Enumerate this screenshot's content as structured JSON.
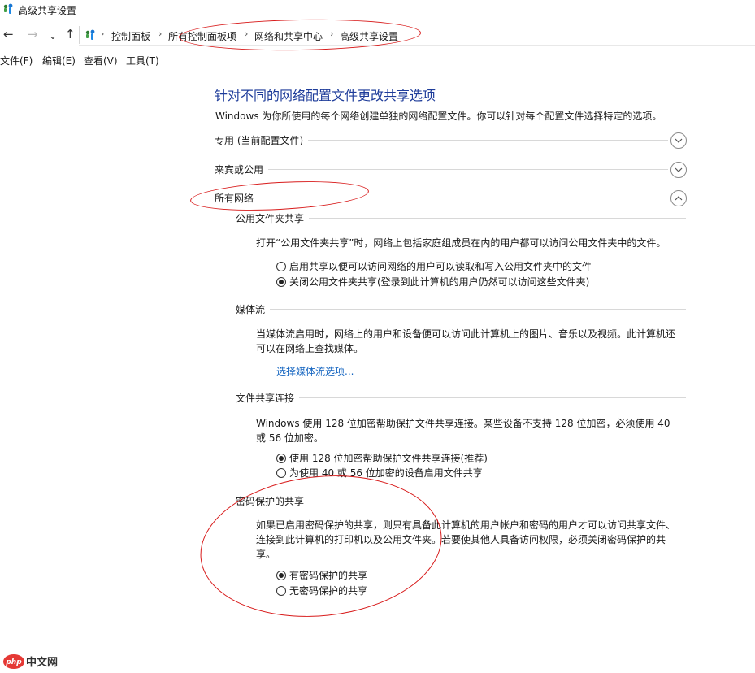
{
  "window": {
    "title": "高级共享设置"
  },
  "navigation": {
    "back": "←",
    "forward": "→",
    "recent": "⌄",
    "up": "↑"
  },
  "breadcrumb": [
    "控制面板",
    "所有控制面板项",
    "网络和共享中心",
    "高级共享设置"
  ],
  "menu": [
    "文件(F)",
    "编辑(E)",
    "查看(V)",
    "工具(T)"
  ],
  "content": {
    "heading": "针对不同的网络配置文件更改共享选项",
    "description": "Windows 为你所使用的每个网络创建单独的网络配置文件。你可以针对每个配置文件选择特定的选项。",
    "profiles": {
      "private": {
        "label": "专用 (当前配置文件)",
        "state": "collapsed",
        "icon": "chevron-down-icon"
      },
      "guest": {
        "label": "来宾或公用",
        "state": "collapsed",
        "icon": "chevron-down-icon"
      },
      "all": {
        "label": "所有网络",
        "state": "expanded",
        "icon": "chevron-up-icon"
      }
    },
    "public_folder": {
      "title": "公用文件夹共享",
      "text": "打开“公用文件夹共享”时，网络上包括家庭组成员在内的用户都可以访问公用文件夹中的文件。",
      "options": [
        {
          "label": "启用共享以便可以访问网络的用户可以读取和写入公用文件夹中的文件",
          "selected": false
        },
        {
          "label": "关闭公用文件夹共享(登录到此计算机的用户仍然可以访问这些文件夹)",
          "selected": true
        }
      ]
    },
    "media": {
      "title": "媒体流",
      "text": "当媒体流启用时，网络上的用户和设备便可以访问此计算机上的图片、音乐以及视频。此计算机还可以在网络上查找媒体。",
      "link": "选择媒体流选项..."
    },
    "file_sharing": {
      "title": "文件共享连接",
      "text": "Windows 使用 128 位加密帮助保护文件共享连接。某些设备不支持 128 位加密，必须使用 40 或 56 位加密。",
      "options": [
        {
          "label": "使用 128 位加密帮助保护文件共享连接(推荐)",
          "selected": true
        },
        {
          "label": "为使用 40 或 56 位加密的设备启用文件共享",
          "selected": false
        }
      ]
    },
    "password": {
      "title": "密码保护的共享",
      "text": "如果已启用密码保护的共享，则只有具备此计算机的用户帐户和密码的用户才可以访问共享文件、连接到此计算机的打印机以及公用文件夹。若要使其他人具备访问权限，必须关闭密码保护的共享。",
      "options": [
        {
          "label": "有密码保护的共享",
          "selected": true
        },
        {
          "label": "无密码保护的共享",
          "selected": false
        }
      ]
    }
  },
  "watermark": {
    "text": "php中文网"
  },
  "colors": {
    "heading": "#1e3c9a",
    "link": "#1565c0",
    "annotation": "#d81b1b"
  }
}
